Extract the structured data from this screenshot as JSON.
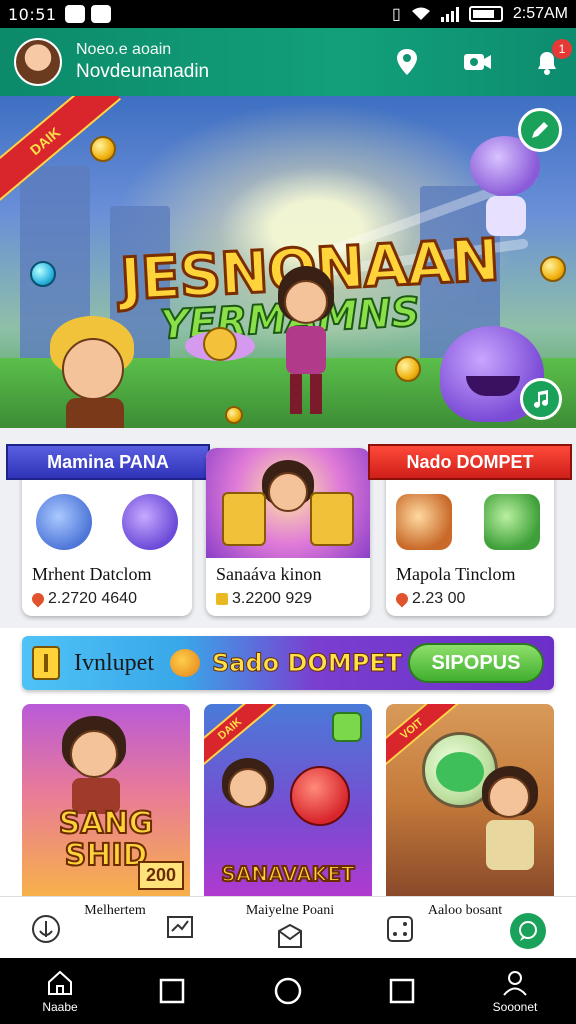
{
  "status_bar": {
    "time": "10:51",
    "clock_right": "2:57AM",
    "icons": [
      "check-icon",
      "chat-icon",
      "vibrate-icon",
      "wifi-icon",
      "signal-icon",
      "battery-icon"
    ]
  },
  "header": {
    "user_label": "Noeo.e aoain",
    "user_name": "Novdeunanadin",
    "actions": [
      "location-pin-icon",
      "video-chat-icon",
      "notification-icon"
    ],
    "notification_count": "1",
    "brand_color": "#0e9470"
  },
  "hero": {
    "ribbon": "DAIK",
    "title_line1": "JESNONAAN",
    "title_line2": "YERMAMNS",
    "top_button_icon": "edit-pen-icon",
    "bottom_button_icon": "music-icon"
  },
  "cards": [
    {
      "banner": "Mamina PANA",
      "title": "Mrhent Datclom",
      "value": "2.2720 4640",
      "currency_icon": "gem-icon"
    },
    {
      "banner": "",
      "title": "Sanaáva kinon",
      "value": "3.2200 929",
      "currency_icon": "cash-icon"
    },
    {
      "banner": "Nado DOMPET",
      "title": "Mapola Tinclom",
      "value": "2.23 00",
      "currency_icon": "gem-icon"
    }
  ],
  "promo": {
    "label": "Ivnlupet",
    "headline": "Sado DOMPET",
    "button": "SIPOPUS"
  },
  "games": [
    {
      "title": "SANG SHID",
      "badge": "200",
      "corner": ""
    },
    {
      "title": "SANAVAKET",
      "badge": "",
      "corner": "DAIK"
    },
    {
      "title": "",
      "badge": "",
      "corner": "VOIT"
    }
  ],
  "bottom_tabs": [
    {
      "label": "Melhertem",
      "icon": "chart-icon"
    },
    {
      "label": "Maiyelne Poani",
      "icon": "inbox-icon"
    },
    {
      "label": "Aaloo bosant",
      "icon": "dice-icon"
    }
  ],
  "nav_bar": {
    "home_label": "Naabe",
    "profile_label": "Sooonet"
  }
}
